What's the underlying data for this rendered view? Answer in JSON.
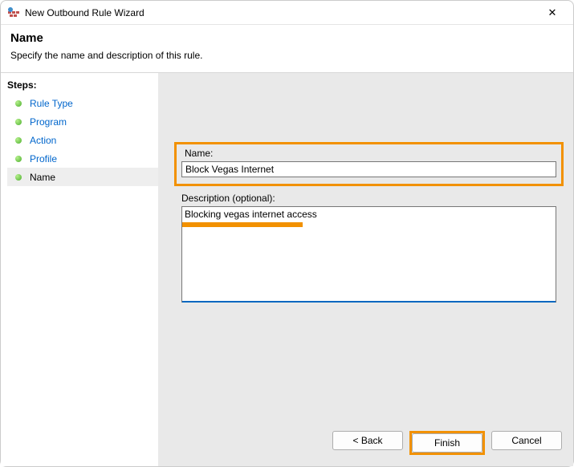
{
  "titlebar": {
    "title": "New Outbound Rule Wizard",
    "close_symbol": "✕"
  },
  "header": {
    "title": "Name",
    "subtitle": "Specify the name and description of this rule."
  },
  "sidebar": {
    "steps_label": "Steps:",
    "items": [
      {
        "label": "Rule Type"
      },
      {
        "label": "Program"
      },
      {
        "label": "Action"
      },
      {
        "label": "Profile"
      },
      {
        "label": "Name"
      }
    ]
  },
  "form": {
    "name_label": "Name:",
    "name_value": "Block Vegas Internet",
    "desc_label": "Description (optional):",
    "desc_value": "Blocking vegas internet access"
  },
  "buttons": {
    "back": "< Back",
    "finish": "Finish",
    "cancel": "Cancel"
  }
}
